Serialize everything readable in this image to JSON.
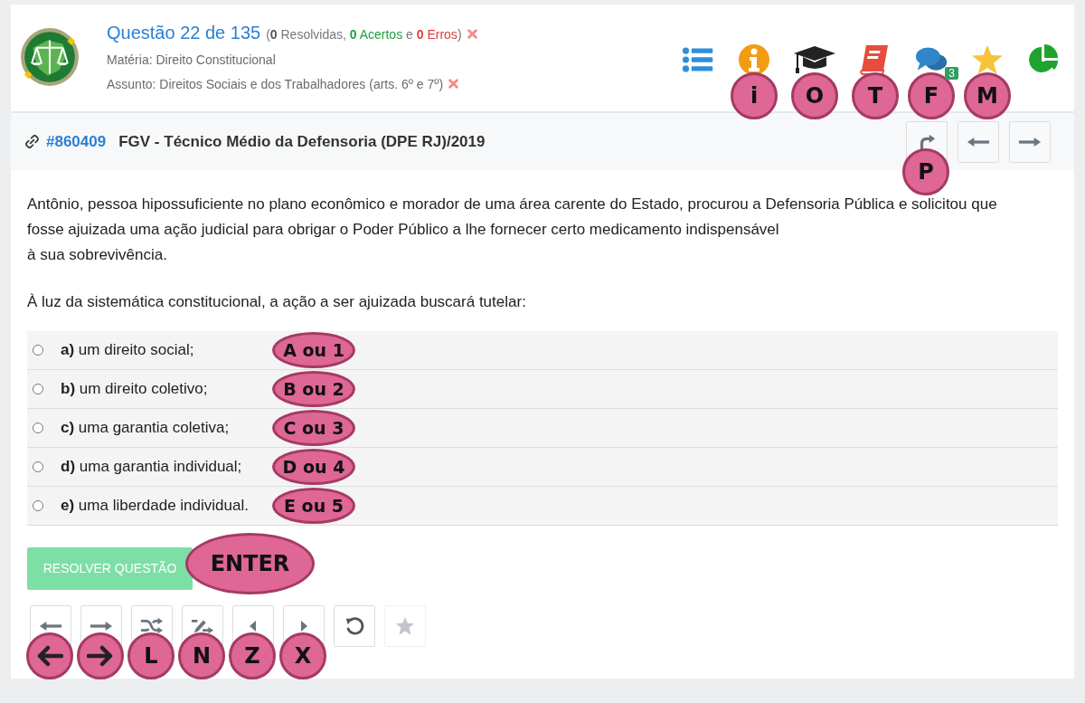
{
  "header": {
    "title": "Questão 22 de 135",
    "summary": [
      {
        "text": "(",
        "kind": "text"
      },
      {
        "text": "0",
        "kind": "count"
      },
      {
        "text": " Resolvidas, ",
        "kind": "text"
      },
      {
        "text": "0",
        "kind": "correct-count"
      },
      {
        "text": " Acertos",
        "kind": "correct"
      },
      {
        "text": " e ",
        "kind": "text"
      },
      {
        "text": "0",
        "kind": "wrong-count"
      },
      {
        "text": " Erros",
        "kind": "wrong"
      },
      {
        "text": ")",
        "kind": "text"
      }
    ],
    "subject": "Matéria: Direito Constitucional",
    "topic": "Assunto: Direitos Sociais e dos Trabalhadores (arts. 6º e 7º)",
    "tools": [
      {
        "kind": "list"
      },
      {
        "kind": "info",
        "hotkey": {
          "kind": "letter",
          "text": "i"
        }
      },
      {
        "kind": "cap",
        "hotkey": {
          "kind": "letter",
          "text": "O"
        }
      },
      {
        "kind": "book",
        "hotkey": {
          "kind": "letter",
          "text": "T"
        }
      },
      {
        "kind": "chat",
        "count": "3",
        "hotkey": {
          "kind": "letter",
          "text": "F"
        }
      },
      {
        "kind": "star",
        "hotkey": {
          "kind": "letter",
          "text": "M"
        }
      },
      {
        "kind": "pie"
      }
    ]
  },
  "question": {
    "id": "#860409",
    "source": "FGV - Técnico Médio da Defensoria (DPE RJ)/2019",
    "nav": [
      {
        "kind": "redo",
        "hotkey": {
          "kind": "letter",
          "text": "P"
        }
      },
      {
        "kind": "prev"
      },
      {
        "kind": "next"
      }
    ]
  },
  "statement": [
    "Antônio, pessoa hipossuficiente no plano econômico e morador de uma área carente do Estado, procurou a Defensoria Pública e solicitou que fosse  ajuizada uma ação judicial para obrigar o Poder Público a lhe fornecer certo medicamento indispensável\nà sua sobrevivência.",
    "À luz da sistemática constitucional, a ação a ser ajuizada buscará tutelar:"
  ],
  "options": [
    {
      "letter": "a)",
      "text": "um direito social;",
      "selected": false,
      "hotkey": {
        "kind": "letter",
        "text": "A ou 1"
      }
    },
    {
      "letter": "b)",
      "text": "um direito coletivo;",
      "selected": false,
      "hotkey": {
        "kind": "letter",
        "text": "B ou 2"
      }
    },
    {
      "letter": "c)",
      "text": "uma garantia coletiva;",
      "selected": false,
      "hotkey": {
        "kind": "letter",
        "text": "C ou 3"
      }
    },
    {
      "letter": "d)",
      "text": "uma garantia individual;",
      "selected": false,
      "hotkey": {
        "kind": "letter",
        "text": "D ou 4"
      }
    },
    {
      "letter": "e)",
      "text": "uma liberdade individual.",
      "selected": false,
      "hotkey": {
        "kind": "letter",
        "text": "E ou 5"
      }
    }
  ],
  "submit": {
    "label": "RESOLVER QUESTÃO",
    "disabled": true,
    "hotkey": {
      "kind": "letter",
      "text": "ENTER"
    }
  },
  "bottom_tools": [
    {
      "kind": "prev",
      "disabled": false,
      "hotkey": {
        "kind": "arrow-left"
      }
    },
    {
      "kind": "next",
      "disabled": false,
      "hotkey": {
        "kind": "arrow-right"
      }
    },
    {
      "kind": "shuffle",
      "disabled": false,
      "hotkey": {
        "kind": "letter",
        "text": "L"
      }
    },
    {
      "kind": "shuffle-edit",
      "disabled": false,
      "hotkey": {
        "kind": "letter",
        "text": "N"
      }
    },
    {
      "kind": "caret-left",
      "disabled": false,
      "hotkey": {
        "kind": "letter",
        "text": "Z"
      }
    },
    {
      "kind": "caret-right",
      "disabled": false,
      "hotkey": {
        "kind": "letter",
        "text": "X"
      }
    },
    {
      "kind": "reset",
      "disabled": false
    },
    {
      "kind": "star",
      "disabled": true
    }
  ]
}
